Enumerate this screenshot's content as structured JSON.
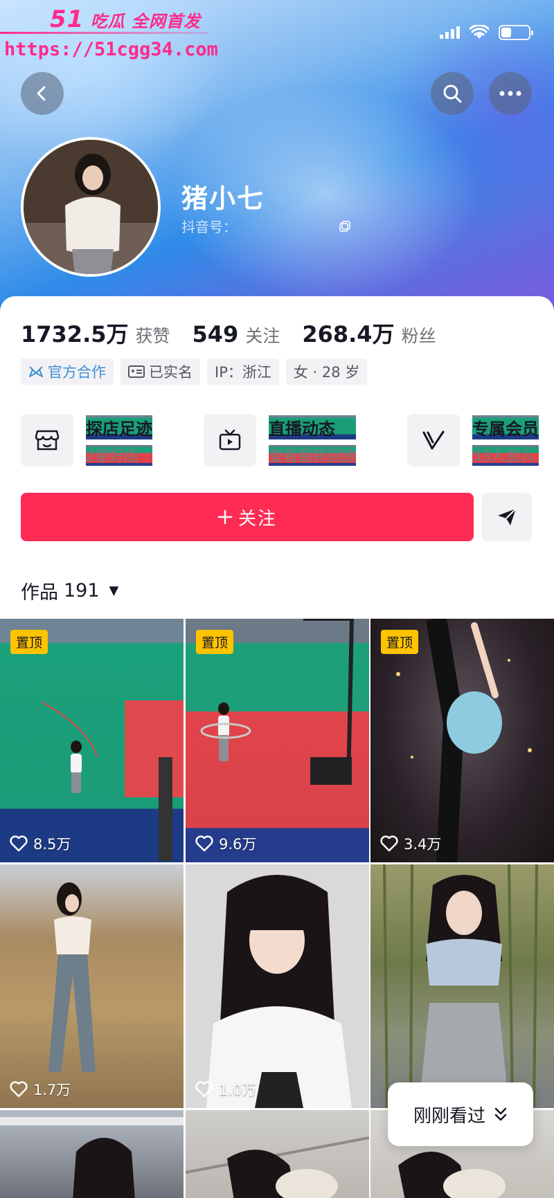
{
  "watermark": {
    "brand": "51",
    "slogan": "吃瓜 全网首发",
    "url": "https://51cgg34.com"
  },
  "profile": {
    "nickname": "猪小七",
    "id_label": "抖音号："
  },
  "stats": [
    {
      "value": "1732.5万",
      "label": "获赞"
    },
    {
      "value": "549",
      "label": "关注"
    },
    {
      "value": "268.4万",
      "label": "粉丝"
    }
  ],
  "tags": [
    {
      "label": "官方合作",
      "icon": "official-cooperation-icon"
    },
    {
      "label": "已实名",
      "icon": "id-card-icon"
    },
    {
      "label": "IP：浙江"
    },
    {
      "label": "女 · 28 岁"
    }
  ],
  "services": [
    {
      "title": "探店足迹",
      "subtitle": "2家好店",
      "icon": "shop-icon"
    },
    {
      "title": "直播动态",
      "subtitle": "查看最新回放",
      "icon": "tv-icon"
    },
    {
      "title": "专属会员",
      "subtitle": "33人加入",
      "icon": "v-member-icon"
    }
  ],
  "actions": {
    "follow_label": "关注",
    "share_icon": "send-icon"
  },
  "works_tab": {
    "label": "作品",
    "count": "191"
  },
  "videos": [
    {
      "pinned": "置顶",
      "likes": "8.5万"
    },
    {
      "pinned": "置顶",
      "likes": "9.6万"
    },
    {
      "pinned": "置顶",
      "likes": "3.4万"
    },
    {
      "likes": "1.7万"
    },
    {
      "likes": "1.0万"
    },
    {
      "likes": ""
    },
    {},
    {},
    {}
  ],
  "recent_pill": {
    "label": "刚刚看过"
  },
  "colors": {
    "primary": "#fe2c55",
    "pin": "#ffc300",
    "official": "#3e8fd6",
    "watermark": "#ff2a8a"
  }
}
